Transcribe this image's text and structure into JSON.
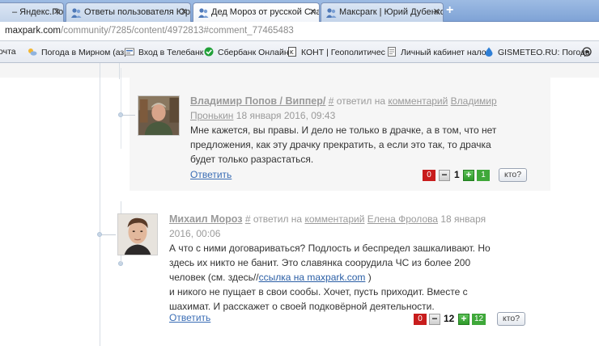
{
  "browser": {
    "tabs": [
      {
        "label": "– Яндекс.Почта",
        "active": false
      },
      {
        "label": "Ответы пользователя Юрия",
        "active": false
      },
      {
        "label": "Дед Мороз от русской Славы",
        "active": true
      },
      {
        "label": "Максparк | Юрий Дубенков",
        "active": false
      }
    ],
    "new_tab_label": "+",
    "url_host": "maxpark.com",
    "url_path": "/community/7285/content/4972813#comment_77465483",
    "bookmarks": [
      {
        "label": "очта",
        "icon": "mail-icon"
      },
      {
        "label": "Погода в Мирном (азр",
        "icon": "weather-icon"
      },
      {
        "label": "Вход в Телебанк",
        "icon": "bank-icon"
      },
      {
        "label": "Сбербанк Онлайн",
        "icon": "sberbank-icon"
      },
      {
        "label": "КОНТ | Геополитичес",
        "icon": "page-icon"
      },
      {
        "label": "Личный кабинет нало",
        "icon": "document-icon"
      },
      {
        "label": "GISMETEO.RU: Погода",
        "icon": "gismeteo-icon"
      }
    ]
  },
  "comments": [
    {
      "author": "Владимир Попов / Виппер/",
      "hash": "#",
      "replied_text": "ответил на",
      "comment_link": "комментарий",
      "target": "Владимир Пронькин",
      "target_line1": "Владимир",
      "target_line2": "Пронькин",
      "date": "18 января 2016, 09:43",
      "body_lines": [
        "Мне кажется, вы правы. И дело не только в драчке, а в том, что нет",
        "предложения, как эту драчку прекратить, а если это так, то драчка",
        "будет только разрастаться."
      ],
      "reply_label": "Ответить",
      "votes": {
        "negative": "0",
        "minus": "−",
        "total": "1",
        "plus": "+",
        "positive": "1",
        "who": "кто?"
      }
    },
    {
      "author": "Михаил Мороз",
      "hash": "#",
      "replied_text": "ответил на",
      "comment_link": "комментарий",
      "target": "Елена Фролова",
      "date_line1": "18 января",
      "date_line2": "2016, 00:06",
      "body_lines": [
        "А что с ними договариваться? Подлость и беспредел зашкаливают. Но",
        "здесь их никто не банит. Это славянка соорудила ЧС из более 200"
      ],
      "body_line3_prefix": "человек (см. здесь//",
      "body_link": "ссылка на maxpark.com",
      "body_line3_suffix": " )",
      "body_lines_after": [
        "и никого не пущает в свои сообы. Хочет, пусть приходит. Вместе с",
        "шахимат. И расскажет о своей подковёрной деятельности."
      ],
      "reply_label": "Ответить",
      "votes": {
        "negative": "0",
        "minus": "−",
        "total": "12",
        "plus": "+",
        "positive": "12",
        "who": "кто?"
      }
    }
  ],
  "colors": {
    "link": "#3a6db5",
    "negative": "#c81d1d",
    "positive": "#3fa83a",
    "meta": "#9a9a9a"
  }
}
